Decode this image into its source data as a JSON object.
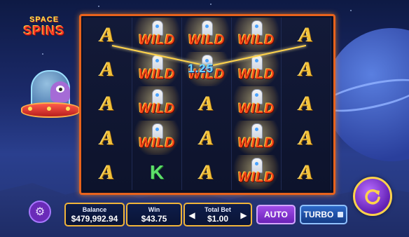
{
  "logo": {
    "line1": "SPACE",
    "line2": "SPINS"
  },
  "reels": {
    "columns": [
      [
        "A",
        "A",
        "A",
        "A",
        "A"
      ],
      [
        "WILD",
        "WILD",
        "WILD",
        "WILD",
        "K"
      ],
      [
        "WILD",
        "WILD",
        "A",
        "A",
        "A"
      ],
      [
        "WILD",
        "WILD",
        "WILD",
        "WILD",
        "WILD"
      ],
      [
        "A",
        "A",
        "A",
        "A",
        "A"
      ]
    ],
    "win_amount": "1.25"
  },
  "hud": {
    "balance_label": "Balance",
    "balance_value": "$479,992.94",
    "win_label": "Win",
    "win_value": "$43.75",
    "bet_label": "Total Bet",
    "bet_value": "$1.00",
    "auto_label": "AUTO",
    "turbo_label": "TURBO"
  },
  "colors": {
    "frame": "#e8621c",
    "panel_border": "#f0b43a",
    "win_line": "#ffd34a",
    "auto_button": "#8a3ad8",
    "turbo_button": "#2c69c8",
    "spin_button": "#7b2cd0"
  },
  "icons": {
    "settings": "gear-icon",
    "spin": "spin-arrow-icon",
    "bet_decrease": "chevron-left-icon",
    "bet_increase": "chevron-right-icon"
  }
}
